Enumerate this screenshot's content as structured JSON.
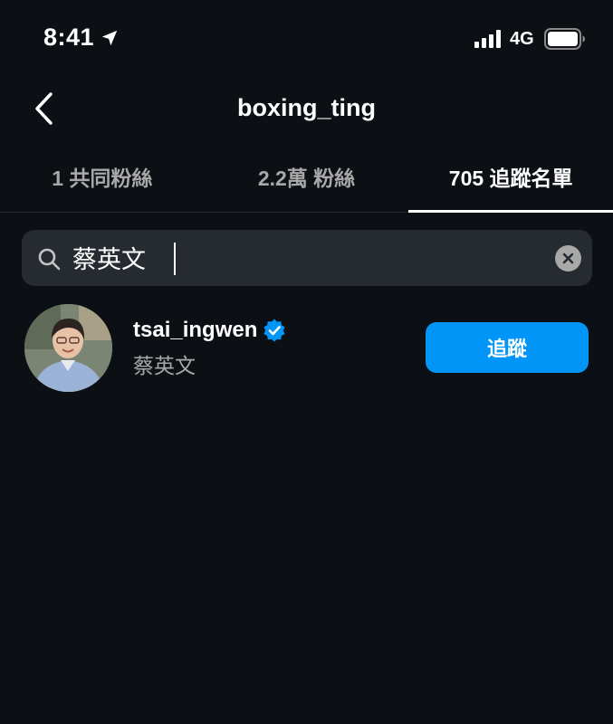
{
  "status_bar": {
    "time": "8:41",
    "network": "4G",
    "icons": [
      "location-arrow-icon",
      "signal-icon",
      "battery-icon"
    ]
  },
  "header": {
    "back_icon": "chevron-left-icon",
    "title": "boxing_ting"
  },
  "tabs": [
    {
      "label": "1 共同粉絲",
      "active": false
    },
    {
      "label": "2.2萬 粉絲",
      "active": false
    },
    {
      "label": "705 追蹤名單",
      "active": true
    }
  ],
  "search": {
    "icon": "search-icon",
    "value": "蔡英文",
    "clear_icon": "clear-icon"
  },
  "results": [
    {
      "username": "tsai_ingwen",
      "verified": true,
      "full_name": "蔡英文",
      "button_label": "追蹤"
    }
  ],
  "colors": {
    "background": "#0c1014",
    "search_bg": "#262a31",
    "secondary_text": "#a8a8a8",
    "follow_button": "#0095f6",
    "verified_badge": "#0095f6"
  }
}
